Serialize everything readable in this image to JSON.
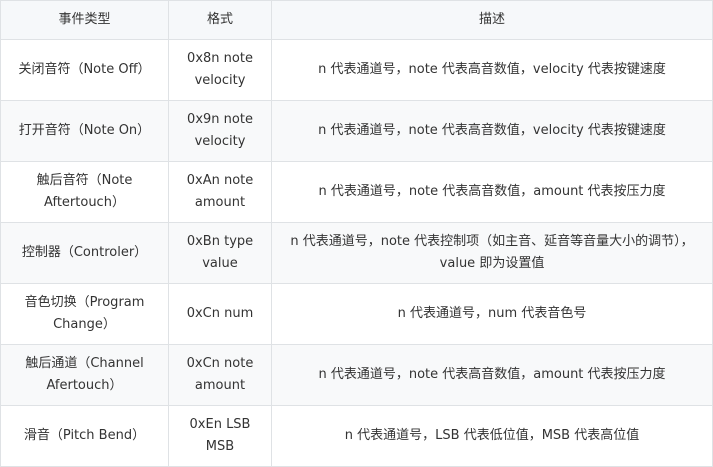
{
  "table": {
    "headers": [
      "事件类型",
      "格式",
      "描述"
    ],
    "rows": [
      {
        "type": "关闭音符（Note Off）",
        "format": "0x8n note velocity",
        "desc": "n 代表通道号，note 代表高音数值，velocity 代表按键速度"
      },
      {
        "type": "打开音符（Note On）",
        "format": "0x9n note velocity",
        "desc": "n 代表通道号，note 代表高音数值，velocity 代表按键速度"
      },
      {
        "type": "触后音符（Note Aftertouch）",
        "format": "0xAn note amount",
        "desc": "n 代表通道号，note 代表高音数值，amount 代表按压力度"
      },
      {
        "type": "控制器（Controler）",
        "format": "0xBn type value",
        "desc": "n 代表通道号，note 代表控制项（如主音、延音等音量大小的调节），value 即为设置值"
      },
      {
        "type": "音色切换（Program Change）",
        "format": "0xCn num",
        "desc": "n 代表通道号，num 代表音色号"
      },
      {
        "type": "触后通道（Channel Afertouch）",
        "format": "0xCn note amount",
        "desc": "n 代表通道号，note 代表高音数值，amount 代表按压力度"
      },
      {
        "type": "滑音（Pitch Bend）",
        "format": "0xEn LSB MSB",
        "desc": "n 代表通道号，LSB 代表低位值，MSB 代表高位值"
      }
    ]
  }
}
